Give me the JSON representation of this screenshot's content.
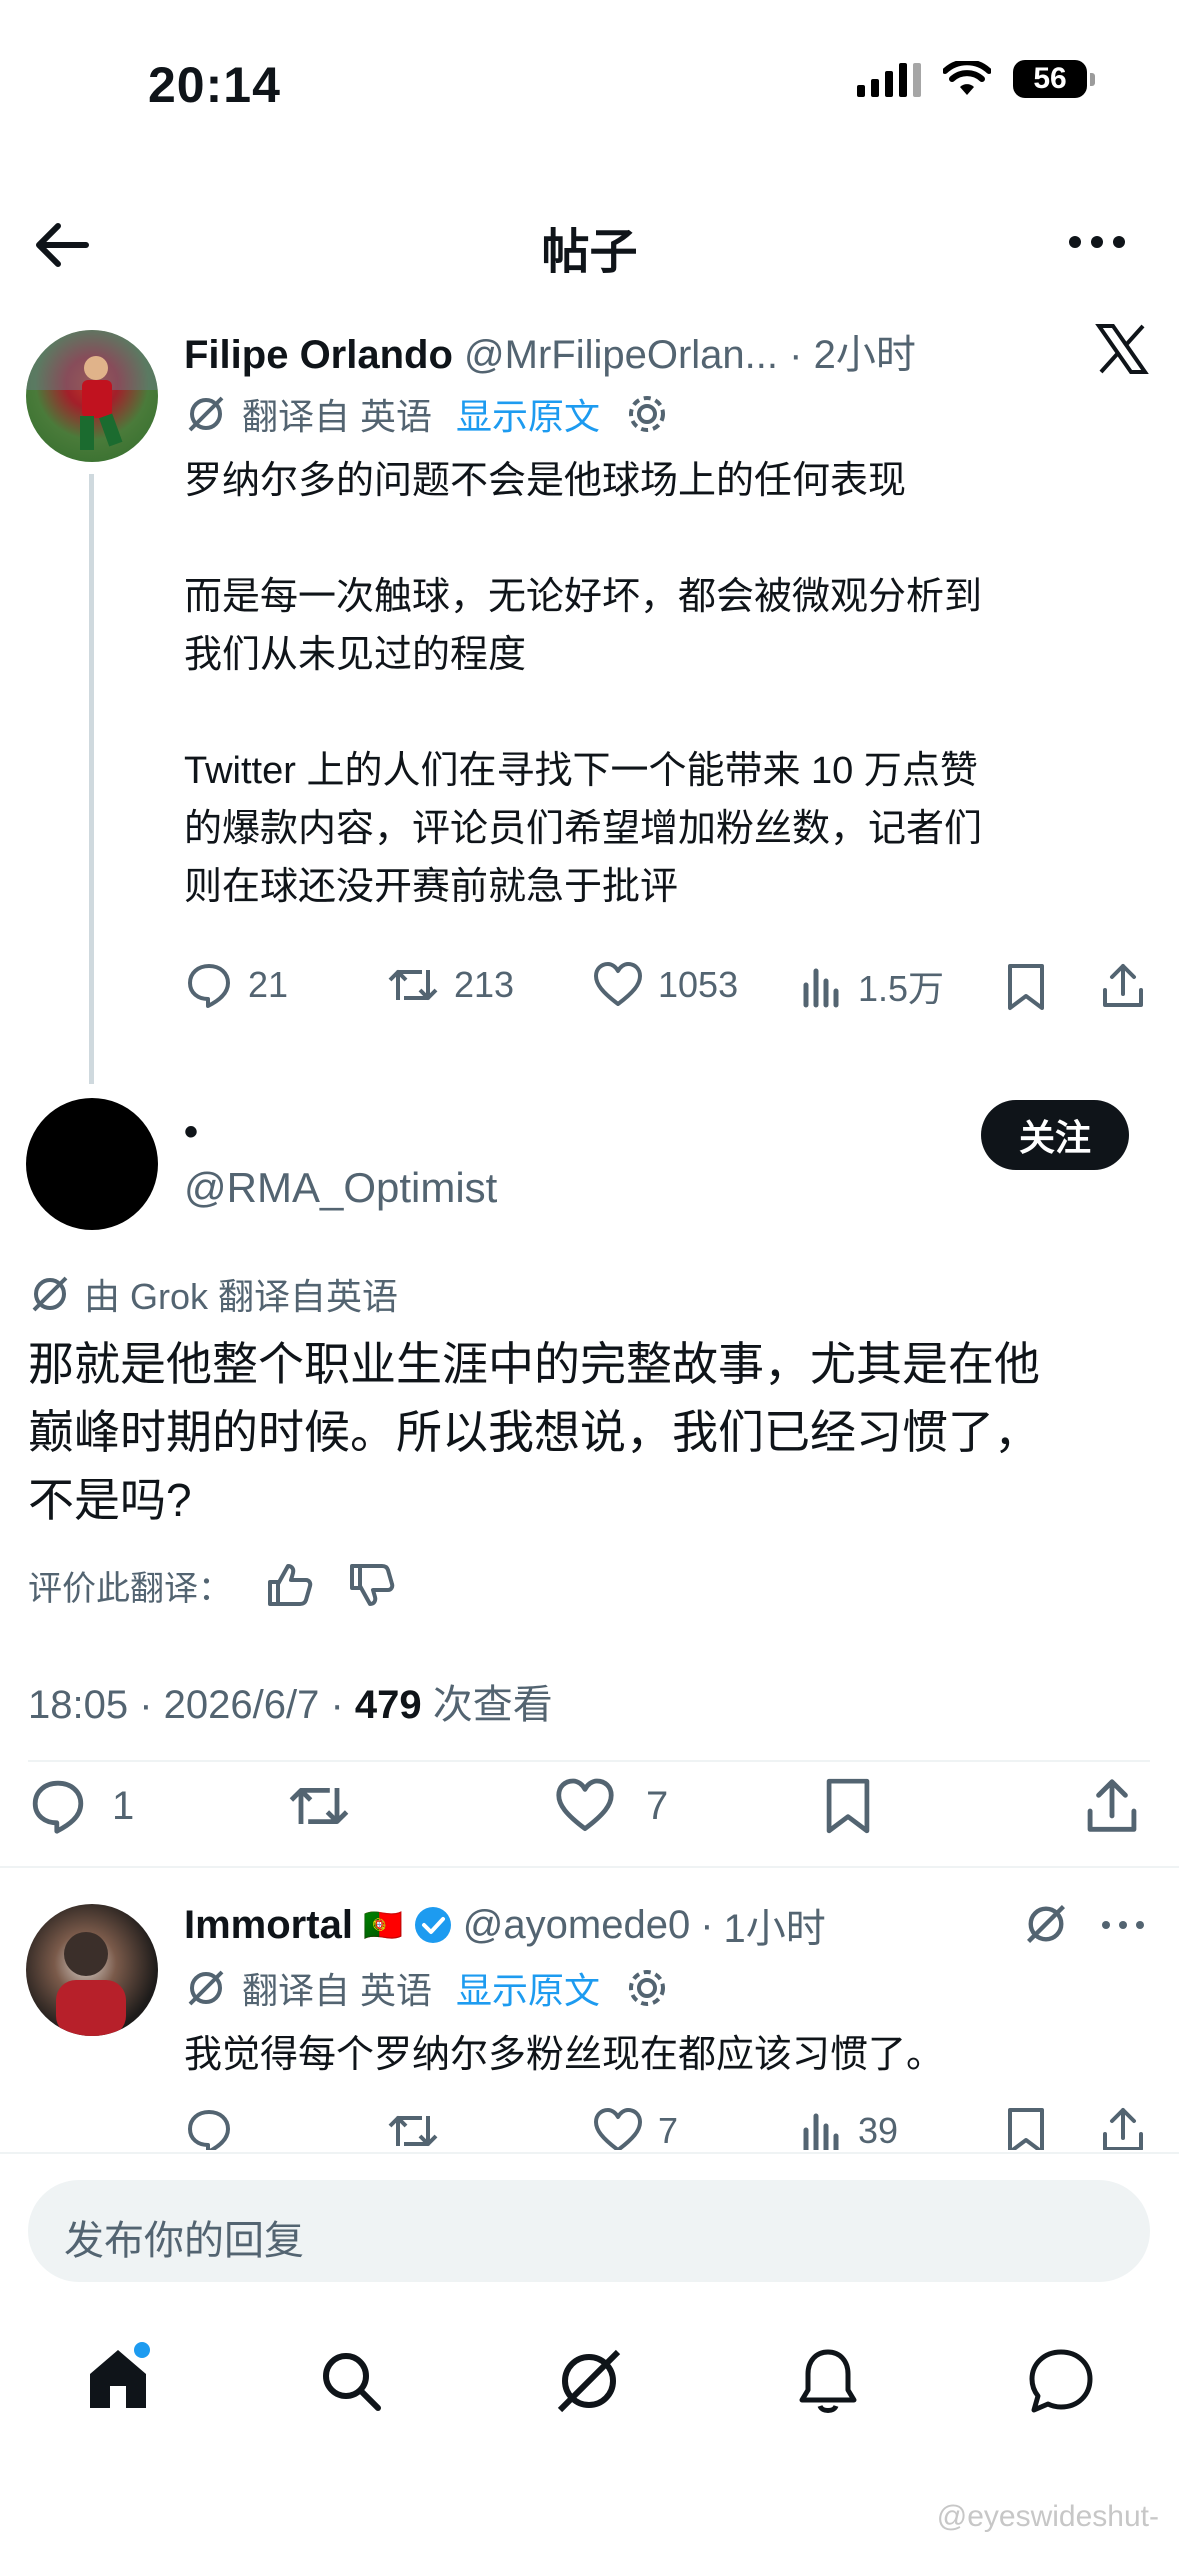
{
  "status": {
    "time": "20:14",
    "battery": "56"
  },
  "header": {
    "title": "帖子"
  },
  "post1": {
    "name": "Filipe Orlando",
    "handle": "@MrFilipeOrlan...",
    "sep": "·",
    "time": "2小时",
    "translated": "翻译自 英语",
    "show_original": "显示原文",
    "lines": [
      "罗纳尔多的问题不会是他球场上的任何表现",
      "而是每一次触球，无论好坏，都会被微观分析到",
      "我们从未见过的程度",
      "Twitter 上的人们在寻找下一个能带来 10 万点赞",
      "的爆款内容，评论员们希望增加粉丝数，记者们",
      "则在球还没开赛前就急于批评"
    ],
    "replies": "21",
    "reposts": "213",
    "likes": "1053",
    "views": "1.5万"
  },
  "main_post": {
    "name": "•",
    "handle": "@RMA_Optimist",
    "follow": "关注",
    "grok": "由 Grok 翻译自英语",
    "lines": [
      "那就是他整个职业生涯中的完整故事，尤其是在他",
      "巅峰时期的时候。所以我想说，我们已经习惯了，",
      "不是吗?"
    ],
    "rate": "评价此翻译：",
    "meta_time": "18:05 · 2026/6/7 · ",
    "meta_views": "479",
    "meta_views_label": " 次查看",
    "replies": "1",
    "likes": "7"
  },
  "reply1": {
    "name": "Immortal",
    "flag": "🇵🇹",
    "handle": "@ayomede0",
    "sep": "·",
    "time": "1小时",
    "translated": "翻译自 英语",
    "show_original": "显示原文",
    "text": "我觉得每个罗纳尔多粉丝现在都应该习惯了。",
    "likes": "7",
    "views": "39"
  },
  "reply_input": {
    "placeholder": "发布你的回复"
  },
  "watermark": "@eyeswideshut-",
  "colors": {
    "accent": "#1d9bf0",
    "text": "#0f1419",
    "muted": "#536471"
  }
}
